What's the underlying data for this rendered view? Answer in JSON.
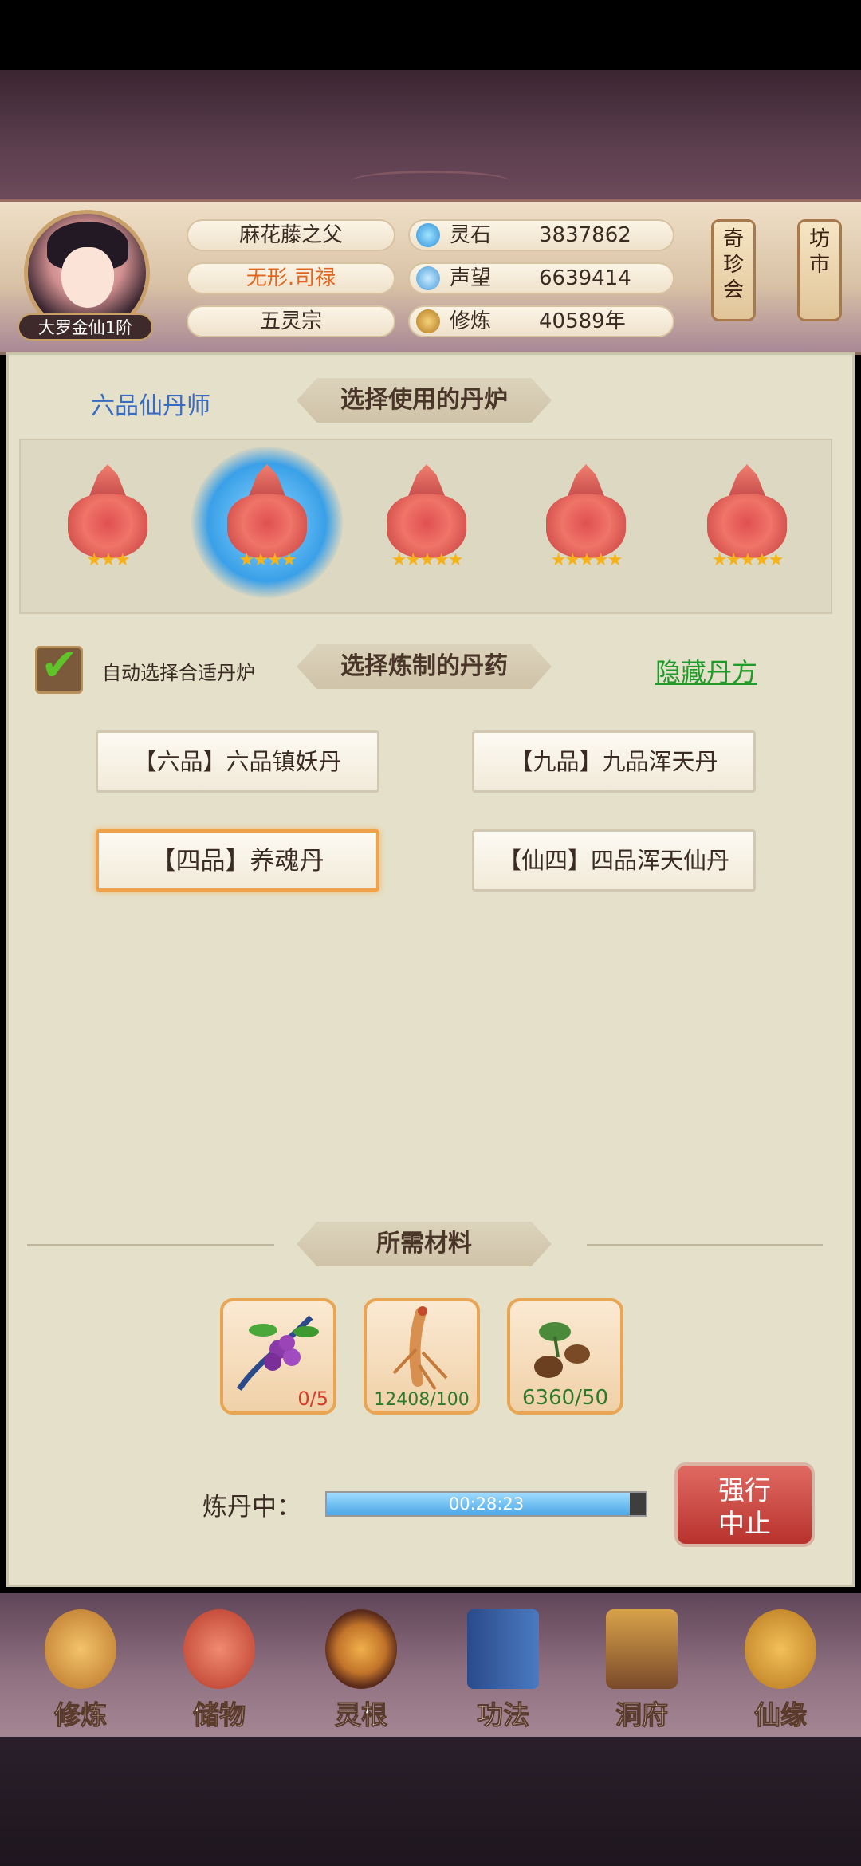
{
  "header": {
    "avatar_rank": "大罗金仙1阶",
    "names": [
      "麻花藤之父",
      "无形.司禄",
      "五灵宗"
    ],
    "resources": [
      {
        "icon": "spirit-stone-icon",
        "label": "灵石",
        "value": "3837862"
      },
      {
        "icon": "reputation-icon",
        "label": "声望",
        "value": "6639414"
      },
      {
        "icon": "cultivation-icon",
        "label": "修炼",
        "value": "40589年"
      }
    ],
    "side_buttons": [
      "奇珍会",
      "坊市"
    ]
  },
  "alchemy": {
    "rank_title": "六品仙丹师",
    "furnace_banner": "选择使用的丹炉",
    "furnaces": [
      {
        "stars": 3,
        "selected": false
      },
      {
        "stars": 4,
        "selected": true
      },
      {
        "stars": 5,
        "selected": false
      },
      {
        "stars": 5,
        "selected": false
      },
      {
        "stars": 5,
        "selected": false
      }
    ],
    "auto_select_label": "自动选择合适丹炉",
    "auto_select_checked": true,
    "pill_banner": "选择炼制的丹药",
    "hide_recipes": "隐藏丹方",
    "recipes": [
      {
        "label": "【六品】六品镇妖丹",
        "active": false
      },
      {
        "label": "【九品】九品浑天丹",
        "active": false
      },
      {
        "label": "【四品】养魂丹",
        "active": true
      },
      {
        "label": "【仙四】四品浑天仙丹",
        "active": false
      }
    ],
    "materials_banner": "所需材料",
    "materials": [
      {
        "icon": "berry-herb-icon",
        "count": "0/5",
        "color": "#d63a2a"
      },
      {
        "icon": "ginseng-icon",
        "count": "12408/100",
        "color": "#2f7a2a"
      },
      {
        "icon": "root-herb-icon",
        "count": "6360/50",
        "color": "#2f7a2a"
      }
    ],
    "progress_label": "炼丹中：",
    "progress_time": "00:28:23",
    "progress_fraction": 0.95,
    "stop_button": [
      "强行",
      "中止"
    ]
  },
  "nav": [
    {
      "icon": "cultivate-icon",
      "label": "修炼"
    },
    {
      "icon": "storage-bag-icon",
      "label": "储物"
    },
    {
      "icon": "spirit-root-icon",
      "label": "灵根"
    },
    {
      "icon": "technique-book-icon",
      "label": "功法"
    },
    {
      "icon": "cave-house-icon",
      "label": "洞府"
    },
    {
      "icon": "fate-gourd-icon",
      "label": "仙缘"
    }
  ]
}
